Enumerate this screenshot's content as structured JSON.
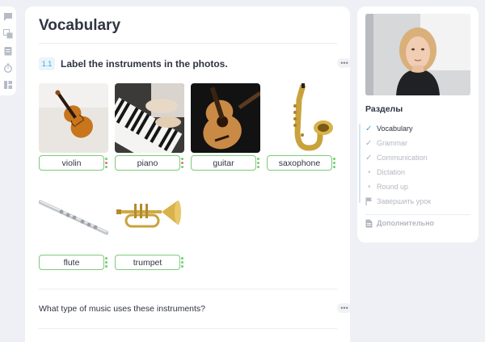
{
  "page_title": "Vocabulary",
  "exercise": {
    "number": "1.1",
    "title": "Label the instruments in the photos.",
    "more": "•••",
    "items": [
      {
        "label": "violin"
      },
      {
        "label": "piano"
      },
      {
        "label": "guitar"
      },
      {
        "label": "saxophone"
      },
      {
        "label": "flute"
      },
      {
        "label": "trumpet"
      }
    ]
  },
  "next_exercise": {
    "question": "What type of music uses these instruments?",
    "more": "•••"
  },
  "sidebar": {
    "title": "Разделы",
    "items": [
      {
        "label": "Vocabulary",
        "state": "active"
      },
      {
        "label": "Grammar",
        "state": "done"
      },
      {
        "label": "Communication",
        "state": "done"
      },
      {
        "label": "Dictation",
        "state": "pending"
      },
      {
        "label": "Round up",
        "state": "pending"
      },
      {
        "label": "Завершить урок",
        "state": "finish"
      }
    ],
    "extra": "Дополнительно"
  },
  "tools": [
    "chat-icon",
    "translate-icon",
    "notes-icon",
    "timer-icon",
    "layout-icon"
  ],
  "colors": {
    "accent": "#4aa3df",
    "correct": "#7ccb7a",
    "background": "#eef0f5"
  }
}
